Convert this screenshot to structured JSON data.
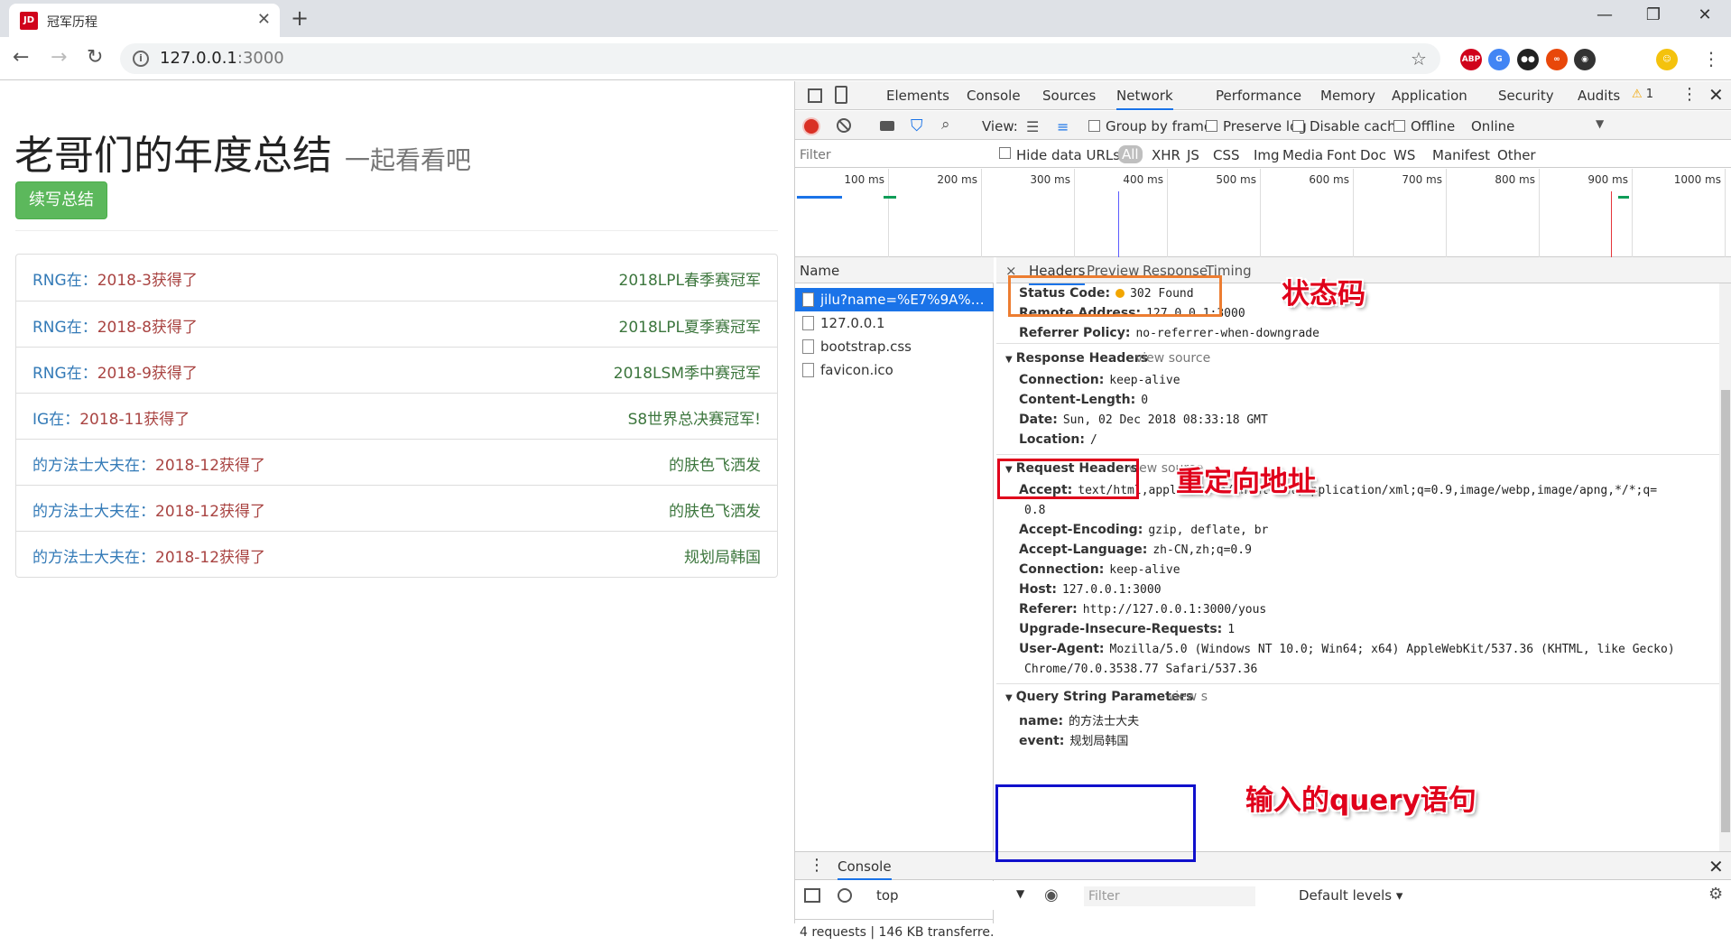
{
  "browser": {
    "tab_title": "冠军历程",
    "tab_favicon": "JD",
    "url_host": "127.0.0.1",
    "url_port": ":3000",
    "extensions": [
      {
        "name": "abp-icon",
        "label": "ABP",
        "color": "#d0021b"
      },
      {
        "name": "translate-icon",
        "label": "G",
        "color": "#4285f4"
      },
      {
        "name": "tampermonkey-icon",
        "label": "●●",
        "color": "#222222"
      },
      {
        "name": "infinity-icon",
        "label": "∞",
        "color": "#e8470a"
      },
      {
        "name": "ninja-icon",
        "label": "◉",
        "color": "#333333"
      },
      {
        "name": "profile-avatar",
        "label": "☺",
        "color": "#f4c20d"
      }
    ]
  },
  "page": {
    "title": "老哥们的年度总结",
    "subtitle": "一起看看吧",
    "button_label": "续写总结",
    "items": [
      {
        "team": "RNG在：",
        "date": "2018-3获得了",
        "award": "2018LPL春季赛冠军"
      },
      {
        "team": "RNG在：",
        "date": "2018-8获得了",
        "award": "2018LPL夏季赛冠军"
      },
      {
        "team": "RNG在：",
        "date": "2018-9获得了",
        "award": "2018LSM季中赛冠军"
      },
      {
        "team": "IG在：",
        "date": "2018-11获得了",
        "award": "S8世界总决赛冠军!"
      },
      {
        "team": "的方法士大夫在：",
        "date": "2018-12获得了",
        "award": "的肤色飞洒发"
      },
      {
        "team": "的方法士大夫在：",
        "date": "2018-12获得了",
        "award": "的肤色飞洒发"
      },
      {
        "team": "的方法士大夫在：",
        "date": "2018-12获得了",
        "award": "规划局韩国"
      }
    ]
  },
  "devtools": {
    "tabs": [
      "Elements",
      "Console",
      "Sources",
      "Network",
      "Performance",
      "Memory",
      "Application",
      "Security",
      "Audits"
    ],
    "warning_count": "1",
    "netbar": {
      "view_label": "View:",
      "group_by_frame": "Group by frame",
      "preserve_log": "Preserve log",
      "disable_cache": "Disable cache",
      "offline": "Offline",
      "online": "Online"
    },
    "filterbar": {
      "placeholder": "Filter",
      "hide_data_urls": "Hide data URLs",
      "types": [
        "All",
        "XHR",
        "JS",
        "CSS",
        "Img",
        "Media",
        "Font",
        "Doc",
        "WS",
        "Manifest",
        "Other"
      ]
    },
    "timeline_ticks": [
      "100 ms",
      "200 ms",
      "300 ms",
      "400 ms",
      "500 ms",
      "600 ms",
      "700 ms",
      "800 ms",
      "900 ms",
      "1000 ms"
    ],
    "requests": {
      "header": "Name",
      "rows": [
        "jilu?name=%E7%9A%84%...",
        "127.0.0.1",
        "bootstrap.css",
        "favicon.ico"
      ],
      "summary": "4 requests | 146 KB transferre..."
    },
    "detail": {
      "tabs": [
        "×",
        "Headers",
        "Preview",
        "Response",
        "Timing"
      ],
      "general": [
        {
          "key": "Status Code:",
          "value": "302 Found"
        },
        {
          "key": "Remote Address:",
          "value": "127.0.0.1:3000"
        },
        {
          "key": "Referrer Policy:",
          "value": "no-referrer-when-downgrade"
        }
      ],
      "response_headers_title": "Response Headers",
      "view_source": "view source",
      "response_headers": [
        {
          "key": "Connection:",
          "value": "keep-alive"
        },
        {
          "key": "Content-Length:",
          "value": "0"
        },
        {
          "key": "Date:",
          "value": "Sun, 02 Dec 2018 08:33:18 GMT"
        },
        {
          "key": "Location:",
          "value": "/"
        }
      ],
      "request_headers_title": "Request Headers",
      "request_headers": [
        {
          "key": "Accept:",
          "value": "text/html,application/xhtml+xml,application/xml;q=0.9,image/webp,image/apng,*/*;q="
        },
        {
          "key": "",
          "value": "0.8"
        },
        {
          "key": "Accept-Encoding:",
          "value": "gzip, deflate, br"
        },
        {
          "key": "Accept-Language:",
          "value": "zh-CN,zh;q=0.9"
        },
        {
          "key": "Connection:",
          "value": "keep-alive"
        },
        {
          "key": "Host:",
          "value": "127.0.0.1:3000"
        },
        {
          "key": "Referer:",
          "value": "http://127.0.0.1:3000/yous"
        },
        {
          "key": "Upgrade-Insecure-Requests:",
          "value": "1"
        },
        {
          "key": "User-Agent:",
          "value": "Mozilla/5.0 (Windows NT 10.0; Win64; x64) AppleWebKit/537.36 (KHTML, like Gecko)"
        },
        {
          "key": "",
          "value": "Chrome/70.0.3538.77 Safari/537.36"
        }
      ],
      "query_title": "Query String Parameters",
      "query_view_source": "view s",
      "query_params": [
        {
          "key": "name:",
          "value": "的方法士大夫"
        },
        {
          "key": "event:",
          "value": "规划局韩国"
        }
      ]
    },
    "drawer": {
      "tab": "Console",
      "context": "top",
      "filter_placeholder": "Filter",
      "levels": "Default levels ▾"
    }
  },
  "annotations": {
    "status_code": "状态码",
    "location": "重定向地址",
    "query": "输入的query语句"
  }
}
